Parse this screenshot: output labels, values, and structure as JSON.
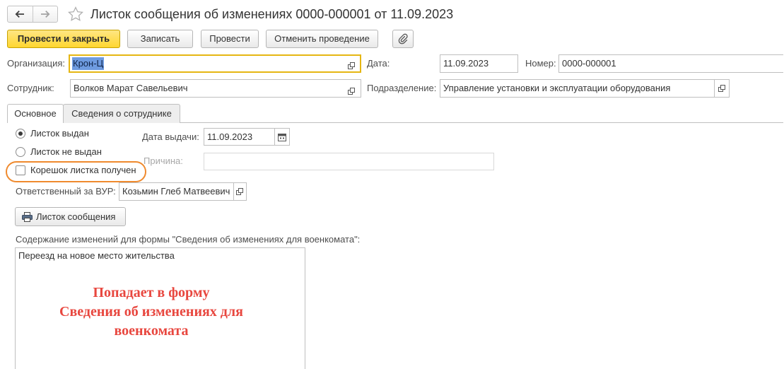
{
  "window": {
    "title": "Листок сообщения об изменениях 0000-000001 от 11.09.2023"
  },
  "icons": {
    "back": "arrow-left-icon",
    "forward": "arrow-right-icon",
    "favorite": "star-icon",
    "attach": "paperclip-icon",
    "open": "open-form-icon",
    "calendar": "calendar-icon",
    "print": "printer-icon"
  },
  "toolbar": {
    "post_and_close_label": "Провести и закрыть",
    "save_label": "Записать",
    "post_label": "Провести",
    "unpost_label": "Отменить проведение"
  },
  "header": {
    "organization": {
      "label": "Организация:",
      "value": "Крон-Ц",
      "focused": true
    },
    "date": {
      "label": "Дата:",
      "value": "11.09.2023"
    },
    "number": {
      "label": "Номер:",
      "value": "0000-000001"
    },
    "employee": {
      "label": "Сотрудник:",
      "value": "Волков Марат Савельевич"
    },
    "department": {
      "label": "Подразделение:",
      "value": "Управление установки и эксплуатации оборудования"
    }
  },
  "tabs": [
    {
      "label": "Основное",
      "active": true
    },
    {
      "label": "Сведения о сотруднике",
      "active": false
    }
  ],
  "main": {
    "issue_status": [
      {
        "label": "Листок выдан",
        "selected": true
      },
      {
        "label": "Листок не выдан",
        "selected": false
      }
    ],
    "stub_received": {
      "label": "Корешок листка получен",
      "checked": false
    },
    "issue_date": {
      "label": "Дата выдачи:",
      "value": "11.09.2023"
    },
    "reason": {
      "label": "Причина:",
      "disabled": true
    },
    "responsible": {
      "label": "Ответственный за ВУР:",
      "value": "Козьмин Глеб Матвеевич"
    },
    "print_button_label": "Листок сообщения",
    "changes_content": {
      "label": "Содержание изменений для формы \"Сведения об изменениях для военкомата\":",
      "value": "Переезд на новое место жительства"
    }
  },
  "annotation": {
    "lines": [
      "Попадает в форму",
      "Сведения об изменениях для",
      "военкомата"
    ]
  },
  "colors": {
    "accent": "#FFD630",
    "focus_border": "#E5B612",
    "selection": "#6E9BE0",
    "annotation_text": "#E8473F",
    "annotation_ring": "#EF8A2E"
  }
}
